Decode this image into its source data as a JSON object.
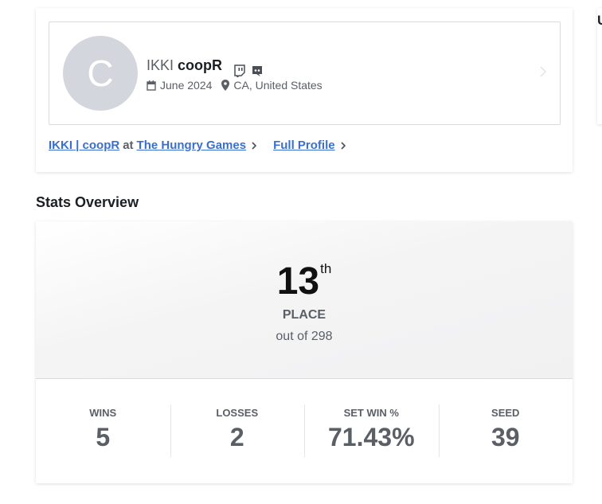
{
  "profile": {
    "avatar_initial": "C",
    "prefix": "IKKI",
    "gamertag": "coopR",
    "social_icons": [
      "twitch-icon",
      "discord-icon"
    ],
    "joined": "June 2024",
    "location": "CA, United States",
    "icons": {
      "calendar": "calendar-icon",
      "location": "location-pin-icon"
    }
  },
  "links": {
    "player_at_event": "IKKI | coopR",
    "at": "at",
    "event_name": "The Hungry Games",
    "full_profile": "Full Profile"
  },
  "sidebar_peek": {
    "letter": "U"
  },
  "stats": {
    "title": "Stats Overview",
    "placement": {
      "number": "13",
      "suffix": "th",
      "label": "PLACE",
      "total": "out of 298"
    },
    "items": [
      {
        "label": "WINS",
        "value": "5"
      },
      {
        "label": "LOSSES",
        "value": "2"
      },
      {
        "label": "SET WIN %",
        "value": "71.43%"
      },
      {
        "label": "SEED",
        "value": "39"
      }
    ]
  },
  "colors": {
    "link": "#3a6fd0",
    "muted": "#5a5f66",
    "avatar_bg": "#d3d6dc"
  }
}
